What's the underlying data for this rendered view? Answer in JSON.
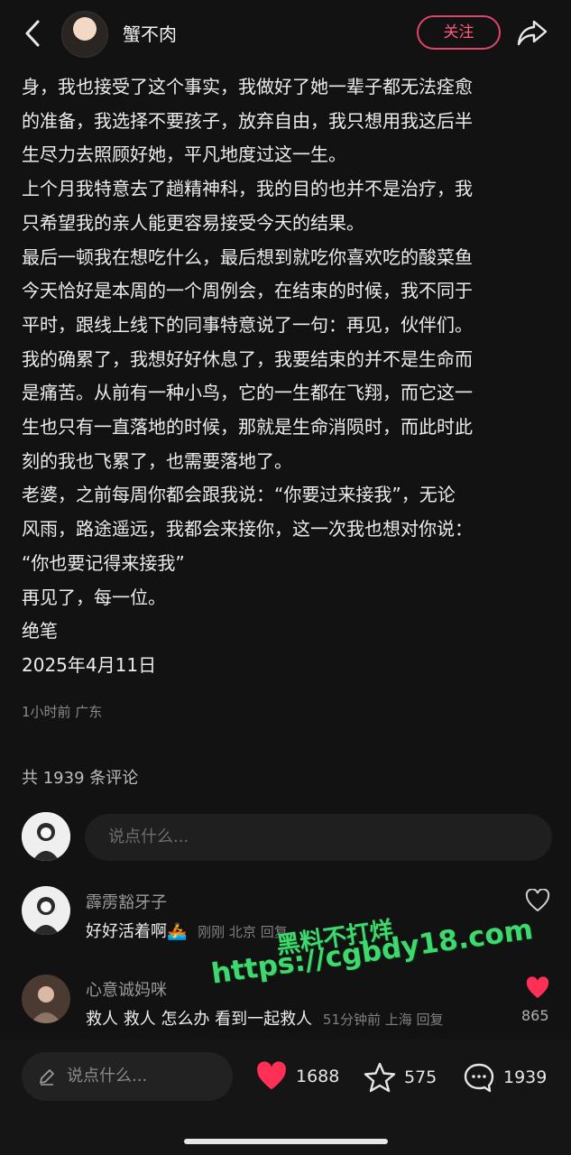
{
  "header": {
    "author_name": "蟹不肉",
    "follow_label": "关注"
  },
  "post": {
    "lines": [
      "身，我也接受了这个事实，我做好了她一辈子都无法痊愈",
      "的准备，我选择不要孩子，放弃自由，我只想用我这后半",
      "生尽力去照顾好她，平凡地度过这一生。",
      "上个月我特意去了趟精神科，我的目的也并不是治疗，我",
      "只希望我的亲人能更容易接受今天的结果。",
      "最后一顿我在想吃什么，最后想到就吃你喜欢吃的酸菜鱼",
      "今天恰好是本周的一个周例会，在结束的时候，我不同于",
      "平时，跟线上线下的同事特意说了一句：再见，伙伴们。",
      "我的确累了，我想好好休息了，我要结束的并不是生命而",
      "是痛苦。从前有一种小鸟，它的一生都在飞翔，而它这一",
      "生也只有一直落地的时候，那就是生命消陨时，而此时此",
      "刻的我也飞累了，也需要落地了。",
      "老婆，之前每周你都会跟我说：“你要过来接我”，无论",
      "风雨，路途遥远，我都会来接你，这一次我也想对你说：",
      "“你也要记得来接我”",
      "再见了，每一位。",
      "绝笔",
      "2025年4月11日"
    ],
    "meta": "1小时前  广东"
  },
  "comments_section": {
    "count_label": "共 1939 条评论",
    "input_placeholder": "说点什么...",
    "comments": [
      {
        "name": "霹雳豁牙子",
        "text": "好好活着啊🚣",
        "meta": "刚刚  北京  回复",
        "liked": false,
        "likes": ""
      },
      {
        "name": "心意诚妈咪",
        "text": "救人 救人 怎么办 看到一起救人",
        "meta": "51分钟前  上海  回复",
        "liked": true,
        "likes": "865"
      }
    ]
  },
  "watermark": {
    "line1": "黑料不打烊",
    "line2": "https://cgbdy18.com"
  },
  "bottom_bar": {
    "input_placeholder": "说点什么...",
    "likes": "1688",
    "favorites": "575",
    "comments": "1939"
  },
  "colors": {
    "accent": "#ff2f55",
    "follow": "#e0456a",
    "watermark": "#3fd86f"
  }
}
